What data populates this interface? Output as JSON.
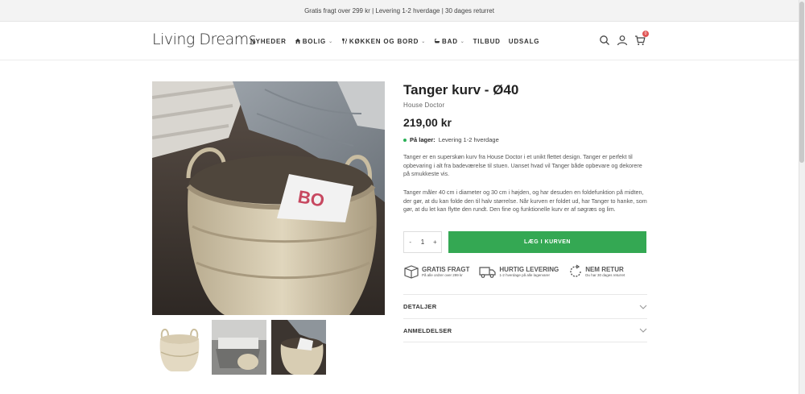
{
  "announcement": "Gratis fragt over 299 kr | Levering 1-2 hverdage | 30 dages returret",
  "logo": "Living Dreams",
  "nav": [
    {
      "label": "NYHEDER",
      "icon": "",
      "dropdown": false
    },
    {
      "label": "BOLIG",
      "icon": "home-icon",
      "dropdown": true
    },
    {
      "label": "KØKKEN OG BORD",
      "icon": "cutlery-icon",
      "dropdown": true
    },
    {
      "label": "BAD",
      "icon": "bath-icon",
      "dropdown": true
    },
    {
      "label": "TILBUD",
      "icon": "",
      "dropdown": false
    },
    {
      "label": "UDSALG",
      "icon": "",
      "dropdown": false
    }
  ],
  "header_icons": [
    "search-icon",
    "user-icon",
    "cart-icon"
  ],
  "cart_count": "0",
  "product": {
    "title": "Tanger kurv - Ø40",
    "brand": "House Doctor",
    "price": "219,00 kr",
    "stock_label": "På lager:",
    "stock_text": "Levering 1-2 hverdage",
    "desc1": "Tanger er en superskøn kurv fra House Doctor i et unikt flettet design. Tanger er perfekt til opbevaring i alt fra badeværelse til stuen. Uanset hvad vil Tanger både opbevare og dekorere på smukkeste vis.",
    "desc2": "Tanger måler 40 cm i diameter og 30 cm i højden, og har desuden en foldefunktion på midten, der gør, at du kan folde den til halv størrelse. Når kurven er foldet ud, har Tanger to hanke, som gør, at du let kan flytte den rundt. Den fine og funktionelle kurv er af søgræs og lim.",
    "quantity": "1",
    "qty_minus": "-",
    "qty_plus": "+",
    "add_to_cart": "LÆG I KURVEN"
  },
  "usps": [
    {
      "icon": "box-icon",
      "title": "GRATIS FRAGT",
      "sub": "På alle ordrer over 299 kr"
    },
    {
      "icon": "truck-icon",
      "title": "HURTIG LEVERING",
      "sub": "1-2 hverdage på alle lagervarer"
    },
    {
      "icon": "return-icon",
      "title": "NEM RETUR",
      "sub": "Du har 30 dages returret"
    }
  ],
  "accordions": [
    {
      "label": "DETALJER"
    },
    {
      "label": "ANMELDELSER"
    }
  ],
  "colors": {
    "accent": "#34a853",
    "badge": "#e05555",
    "stock_dot": "#2bb158"
  }
}
